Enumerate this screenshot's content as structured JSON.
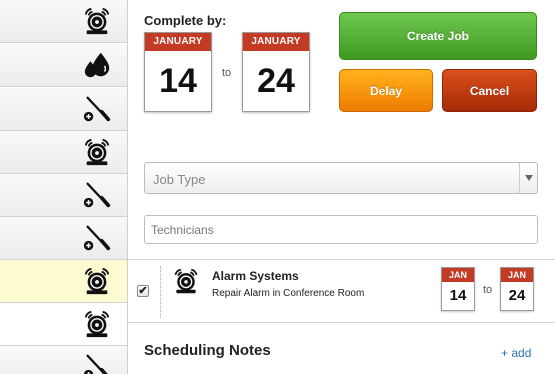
{
  "sidebar": {
    "items": [
      {
        "icon": "alarm-bell-icon",
        "state": "normal"
      },
      {
        "icon": "water-drops-icon",
        "state": "normal"
      },
      {
        "icon": "screwdriver-icon",
        "state": "normal"
      },
      {
        "icon": "alarm-bell-icon",
        "state": "normal"
      },
      {
        "icon": "screwdriver-icon",
        "state": "normal"
      },
      {
        "icon": "screwdriver-icon",
        "state": "normal"
      },
      {
        "icon": "alarm-bell-icon",
        "state": "highlighted"
      },
      {
        "icon": "alarm-bell-icon",
        "state": "selected"
      },
      {
        "icon": "screwdriver-icon",
        "state": "normal"
      }
    ]
  },
  "complete_by": {
    "label": "Complete by:",
    "start": {
      "month": "JANUARY",
      "day": "14"
    },
    "to_label": "to",
    "end": {
      "month": "JANUARY",
      "day": "24"
    }
  },
  "buttons": {
    "create": "Create Job",
    "delay": "Delay",
    "cancel": "Cancel"
  },
  "job_type": {
    "placeholder": "Job Type"
  },
  "technicians": {
    "placeholder": "Technicians"
  },
  "job": {
    "checked": true,
    "check_mark": "✔",
    "title": "Alarm Systems",
    "description": "Repair Alarm in Conference Room",
    "start": {
      "month": "JAN",
      "day": "14"
    },
    "to_label": "to",
    "end": {
      "month": "JAN",
      "day": "24"
    }
  },
  "notes": {
    "title": "Scheduling Notes",
    "add_label": "+ add"
  },
  "colors": {
    "create": "#4caf2e",
    "delay": "#f59300",
    "cancel": "#b8360d",
    "calendar_header": "#c33a25",
    "highlight_row": "#fdfbd2",
    "link": "#2f6fb0"
  }
}
